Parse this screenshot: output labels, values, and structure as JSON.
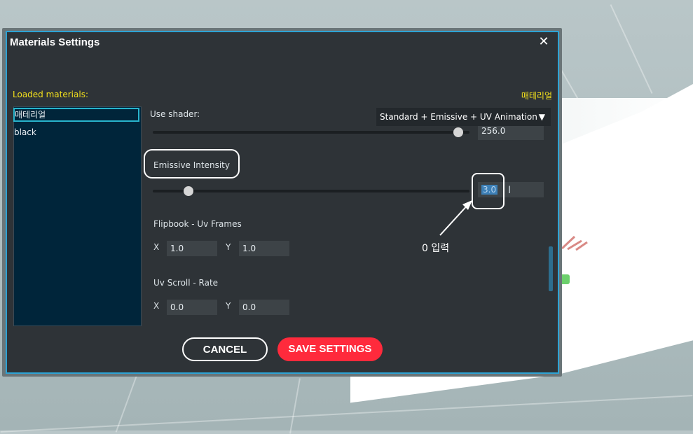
{
  "dialog": {
    "title": "Materials Settings",
    "close_symbol": "✕",
    "loaded_label": "Loaded materials:",
    "current_material": "매테리얼"
  },
  "materials": {
    "items": [
      {
        "label": "매테리얼",
        "selected": true
      },
      {
        "label": "black",
        "selected": false
      }
    ]
  },
  "shader": {
    "label": "Use shader:",
    "value": "Standard + Emissive + UV Animation",
    "arrow": "▼"
  },
  "prev_slider": {
    "value_text": "256.0",
    "fraction": 0.98
  },
  "emissive": {
    "label": "Emissive Intensity",
    "value_text": "3.0",
    "fraction": 0.1
  },
  "flipbook": {
    "label": "Flipbook - Uv Frames",
    "x_label": "X",
    "x_value": "1.0",
    "y_label": "Y",
    "y_value": "1.0"
  },
  "uvscroll": {
    "label": "Uv Scroll - Rate",
    "x_label": "X",
    "x_value": "0.0",
    "y_label": "Y",
    "y_value": "0.0"
  },
  "buttons": {
    "cancel": "CANCEL",
    "save": "SAVE SETTINGS"
  },
  "annotation": {
    "text": "0 입력"
  },
  "colors": {
    "accent_border": "#2ea3d4",
    "yellow_label": "#f4e11c",
    "save_button": "#ff2a3c",
    "list_bg": "#00253a"
  }
}
